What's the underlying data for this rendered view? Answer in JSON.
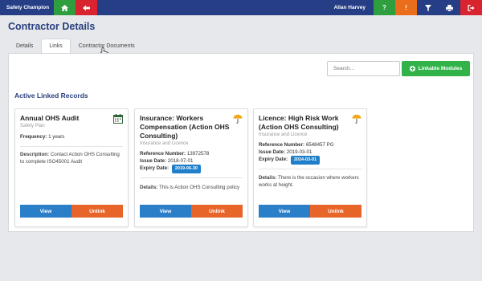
{
  "topbar": {
    "brand": "Safety Champion",
    "user": "Allan Harvey",
    "icons": [
      "home-icon",
      "back-arrow-icon",
      "help-icon",
      "alert-icon",
      "filter-icon",
      "print-icon",
      "logout-icon"
    ],
    "help_glyph": "?",
    "alert_glyph": "!"
  },
  "page": {
    "title": "Contractor Details",
    "tabs": [
      "Details",
      "Links",
      "Contractor Documents"
    ],
    "active_tab": "Links"
  },
  "panel": {
    "search_placeholder": "Search...",
    "add_button": "Linkable Modules",
    "section_title": "Active Linked Records"
  },
  "colors": {
    "navbar": "#263e86",
    "green": "#2e9e3e",
    "red": "#d9232f",
    "orange": "#ea6d1c",
    "badge_blue": "#1f7fc9",
    "view": "#2a7fc8",
    "unlink": "#e8652a"
  },
  "cards": [
    {
      "title": "Annual OHS Audit",
      "subtitle": "Safety Plan",
      "icon": "calendar-icon",
      "frequency_label": "Frequency:",
      "frequency_value": "1 years",
      "desc_label": "Description:",
      "desc_value": "Contact Action OHS Consulting to complete ISO45001 Audit",
      "view": "View",
      "unlink": "Unlink"
    },
    {
      "title": "Insurance: Workers Compensation (Action OHS Consulting)",
      "subtitle": "Insurance and Licence",
      "icon": "umbrella-icon",
      "ref_label": "Reference Number:",
      "ref_value": "13972578",
      "issue_label": "Issue Date:",
      "issue_value": "2018-07-01",
      "expiry_label": "Expiry Date:",
      "expiry_value": "2019-06-30",
      "details_label": "Details:",
      "details_value": "This is Action OHS Consulting policy",
      "view": "View",
      "unlink": "Unlink"
    },
    {
      "title": "Licence: High Risk Work (Action OHS Consulting)",
      "subtitle": "Insurance and Licence",
      "icon": "umbrella-icon",
      "ref_label": "Reference Number:",
      "ref_value": "6548457 PG",
      "issue_label": "Issue Date:",
      "issue_value": "2019-03-01",
      "expiry_label": "Expiry Date:",
      "expiry_value": "2024-03-01",
      "details_label": "Details:",
      "details_value": "There is the occasion where workers works at height.",
      "view": "View",
      "unlink": "Unlink"
    }
  ]
}
